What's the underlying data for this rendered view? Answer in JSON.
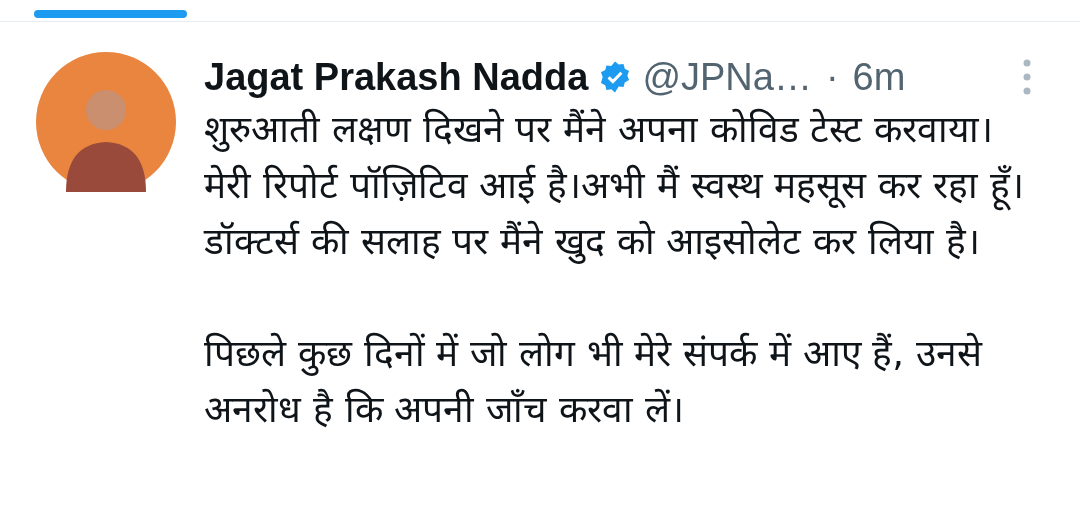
{
  "tweet": {
    "author": {
      "name": "Jagat Prakash Nadda",
      "verified": true,
      "handle": "@JPNa…",
      "separator": "·",
      "time": "6m"
    },
    "paragraphs": [
      "शुरुआती लक्षण दिखने पर मैंने अपना कोविड टेस्ट करवाया।मेरी रिपोर्ट पॉज़िटिव आई है।अभी मैं स्वस्थ महसूस कर रहा हूँ। डॉक्टर्स की सलाह पर मैंने खुद को आइसोलेट कर लिया है।",
      "पिछले कुछ दिनों में जो लोग भी मेरे संपर्क में आए हैं, उनसे अनरोध है कि अपनी जाँच करवा लें।"
    ]
  }
}
